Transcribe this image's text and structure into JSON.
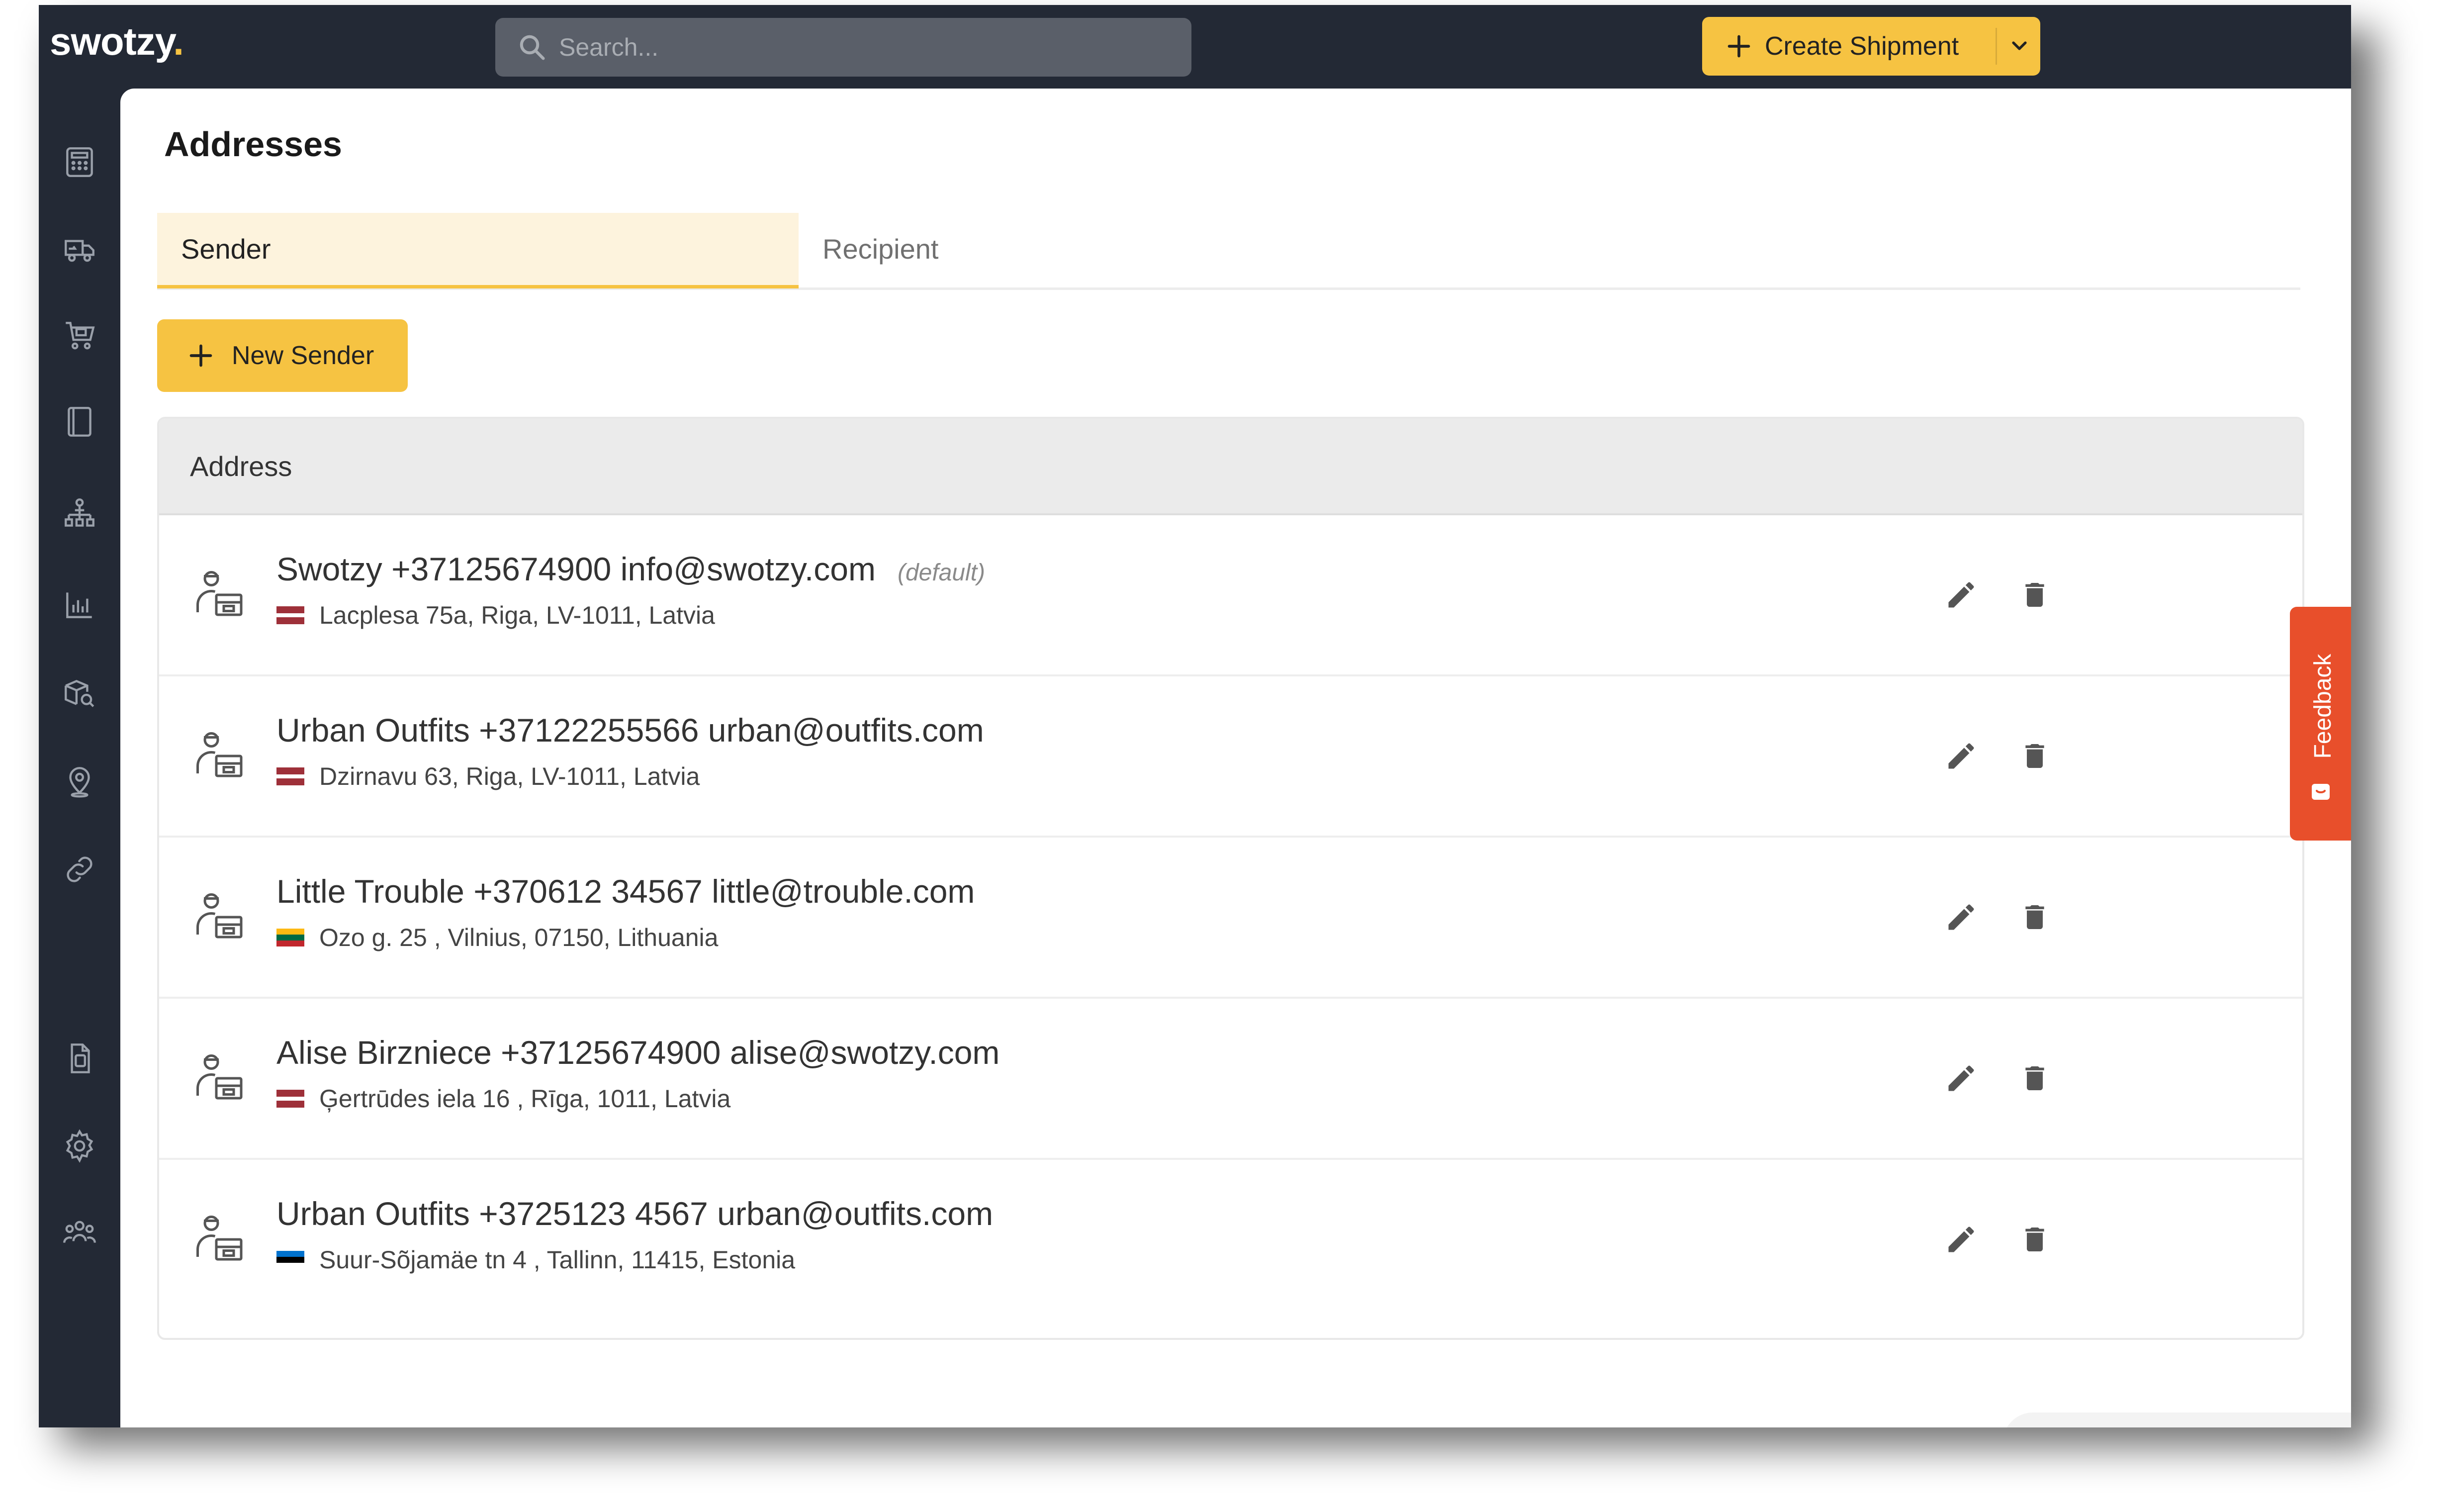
{
  "app": {
    "logo_text": "swotzy",
    "logo_dot": ".",
    "accent_color": "#f6c342",
    "sidebar_bg": "#232935"
  },
  "header": {
    "search_placeholder": "Search...",
    "create_button_label": "Create Shipment",
    "create_button_icon": "plus-icon",
    "create_dropdown_icon": "chevron-down-icon"
  },
  "sidebar": {
    "items": [
      {
        "icon": "calculator-icon"
      },
      {
        "icon": "delivery-truck-icon"
      },
      {
        "icon": "shopping-cart-icon"
      },
      {
        "icon": "tablet-icon"
      },
      {
        "icon": "warehouse-network-icon"
      },
      {
        "icon": "bar-chart-icon"
      },
      {
        "icon": "package-search-icon"
      },
      {
        "icon": "location-pin-icon"
      },
      {
        "icon": "link-icon"
      },
      {
        "icon": "document-icon"
      },
      {
        "icon": "settings-gear-icon"
      },
      {
        "icon": "users-icon"
      }
    ]
  },
  "page": {
    "title": "Addresses",
    "tabs": [
      {
        "label": "Sender",
        "active": true
      },
      {
        "label": "Recipient",
        "active": false
      }
    ],
    "new_button_label": "New Sender",
    "table": {
      "header": "Address",
      "rows": [
        {
          "title": "Swotzy +37125674900 info@swotzy.com",
          "tag": "(default)",
          "address": "Lacplesa 75a, Riga, LV-1011, Latvia",
          "flag": [
            "#9e3039",
            "#ffffff",
            "#9e3039"
          ]
        },
        {
          "title": "Urban Outfits +37122255566 urban@outfits.com",
          "tag": "",
          "address": "Dzirnavu 63, Riga, LV-1011, Latvia",
          "flag": [
            "#9e3039",
            "#ffffff",
            "#9e3039"
          ]
        },
        {
          "title": "Little Trouble +370612 34567 little@trouble.com",
          "tag": "",
          "address": "Ozo g. 25 , Vilnius, 07150, Lithuania",
          "flag": [
            "#fdb913",
            "#006a44",
            "#c1272d"
          ]
        },
        {
          "title": "Alise Birzniece +37125674900 alise@swotzy.com",
          "tag": "",
          "address": "Ģertrūdes iela 16 , Rīga, 1011, Latvia",
          "flag": [
            "#9e3039",
            "#ffffff",
            "#9e3039"
          ]
        },
        {
          "title": "Urban Outfits +3725123 4567 urban@outfits.com",
          "tag": "",
          "address": "Suur-Sõjamäe tn 4 , Tallinn, 11415, Estonia",
          "flag": [
            "#0072ce",
            "#000000",
            "#ffffff"
          ]
        }
      ]
    }
  },
  "feedback": {
    "label": "Feedback",
    "color": "#e84f2b"
  }
}
